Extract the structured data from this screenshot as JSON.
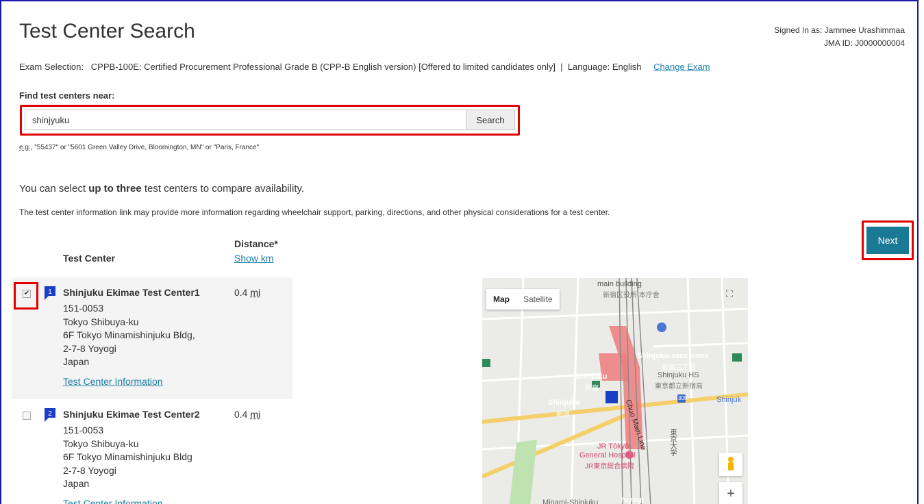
{
  "page": {
    "title": "Test Center Search",
    "signed_in_as": "Signed In as: Jammee Urashimmaa",
    "jma_id": "JMA ID: J0000000004"
  },
  "exam": {
    "selection_text": "Exam Selection:   CPPB-100E: Certified Procurement Professional Grade B (CPP-B English version) [Offered to limited candidates only]  |  Language: English",
    "change_link": "Change Exam"
  },
  "search": {
    "label": "Find test centers near:",
    "value": "shinjyuku",
    "button": "Search",
    "example_prefix": "e.g.",
    "example_text": ", \"55437\" or \"5601 Green Valley Drive, Bloomington, MN\" or \"Paris, France\""
  },
  "info": {
    "select_prefix": "You can select ",
    "select_bold": "up to three",
    "select_suffix": " test centers to compare availability.",
    "details": "The test center information link may provide more information regarding wheelchair support, parking, directions, and other physical considerations for a test center."
  },
  "next_button": "Next",
  "table": {
    "header_center": "Test Center",
    "header_distance": "Distance*",
    "show_km": "Show km"
  },
  "centers": [
    {
      "marker": "1",
      "name": "Shinjuku Ekimae Test Center1",
      "distance": "0.4",
      "unit": "mi",
      "checked": true,
      "checkmark": "✔",
      "postal": "151-0053",
      "city": "Tokyo Shibuya-ku",
      "line1": "6F Tokyo Minamishinjuku Bldg,",
      "line2": "2-7-8 Yoyogi",
      "country": "Japan",
      "link": "Test Center Information"
    },
    {
      "marker": "2",
      "name": "Shinjuku Ekimae Test Center2",
      "distance": "0.4",
      "unit": "mi",
      "checked": false,
      "checkmark": "",
      "postal": "151-0053",
      "city": "Tokyo Shibuya-ku",
      "line1": "6F Tokyo Minamishinjuku Bldg",
      "line2": "2-7-8 Yoyogi",
      "country": "Japan",
      "link": "Test Center Information"
    }
  ],
  "map": {
    "map_tab": "Map",
    "satellite_tab": "Satellite",
    "zoom_in": "+",
    "labels": {
      "main_building": "main building",
      "main_building_jp": "新宿区役所 本庁舎",
      "shinjuku_sanchome": "Shinjuku-sanchome",
      "shinjuku_sanchome_jp": "新宿三丁目",
      "shinjuku_hs": "Shinjuku HS",
      "shinjuku_hs_jp": "東京都立新宿高",
      "shinjuku_station": "Shinjuku",
      "shinjuku_station_jp": "新宿",
      "shinjuku_west": "Shinjuku",
      "shinjuku_west_jp": "新宿",
      "shinjuku_east": "Shinjuk",
      "chuo_line": "Chuo Main Line",
      "jr_hospital": "JR Tōkyō",
      "jr_hospital2": "General Hospital",
      "jr_hospital_jp": "JR東京総合病院",
      "yoyogi": "Yoyogi",
      "minami": "Minami-Shinjuku",
      "route_num": "305",
      "vertical_jp": "東京大学"
    }
  },
  "colors": {
    "accent": "#1a7a96",
    "link": "#1a7fa6",
    "highlight": "#e00000",
    "border": "#1a1aa8"
  }
}
